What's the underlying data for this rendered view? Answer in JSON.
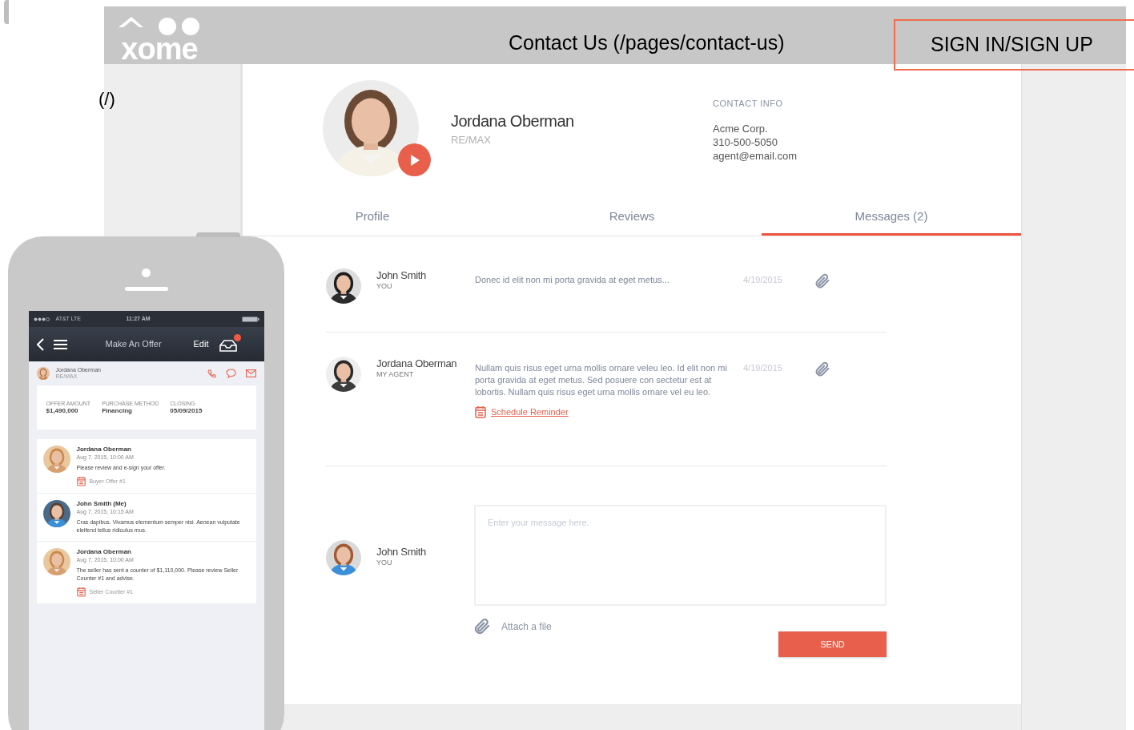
{
  "header": {
    "home_link": "(/)",
    "logo": "xome",
    "nav_link": "Contact Us (/pages/contact-us)",
    "sign_in": "SIGN IN/SIGN UP"
  },
  "profile": {
    "name": "Jordana Oberman",
    "brokerage": "RE/MAX",
    "contact_label": "CONTACT INFO",
    "contact_lines": [
      "Acme Corp.",
      "310-500-5050",
      "agent@email.com"
    ]
  },
  "tabs": [
    {
      "label": "Profile",
      "selected": false
    },
    {
      "label": "Reviews",
      "selected": false
    },
    {
      "label": "Messages (2)",
      "selected": true
    }
  ],
  "messages": [
    {
      "sender": "John Smith",
      "role": "YOU",
      "text": "Donec id elit non mi porta gravida at eget metus...",
      "date": "4/19/2015"
    },
    {
      "sender": "Jordana Oberman",
      "role": "MY AGENT",
      "text": "Nullam quis risus eget urna mollis ornare veleu leo. Id elit non mi porta gravida at eget metus. Sed posuere con sectetur est at lobortis. Nullam quis risus eget urna mollis ornare vel eu leo.",
      "date": "4/19/2015",
      "reminder": "Schedule Reminder"
    }
  ],
  "composer": {
    "sender": "John Smith",
    "role": "YOU",
    "placeholder": "Enter your message here.",
    "attach": "Attach a file",
    "send": "SEND"
  },
  "phone": {
    "carrier": "AT&T LTE",
    "time": "11:27 AM",
    "title": "Make An Offer",
    "edit": "Edit",
    "contact": "Jordana Oberman",
    "contact_sub": "RE/MAX",
    "summary": [
      {
        "label": "OFFER AMOUNT",
        "value": "$1,490,000"
      },
      {
        "label": "PURCHASE METHOD",
        "value": "Financing"
      },
      {
        "label": "CLOSING",
        "value": "05/09/2015"
      }
    ],
    "messages": [
      {
        "sender": "Jordana Oberman",
        "time": "Aug 7, 2015, 10:00 AM",
        "text": "Please review and e-sign your offer.",
        "attachment": "Buyer Offer #1"
      },
      {
        "sender": "John Smith (Me)",
        "time": "Aug 7, 2015, 10:15 AM",
        "text": "Cras dapibus. Vivamus elementum semper nisi. Aenean vulputate eleifend tellus ridiculus mus."
      },
      {
        "sender": "Jordana Oberman",
        "time": "Aug 7, 2015, 10:00 AM",
        "text": "The seller has sent a counter of $1,110,000. Please review Seller Counter #1 and advise.",
        "attachment": "Seller Counter #1"
      }
    ]
  }
}
